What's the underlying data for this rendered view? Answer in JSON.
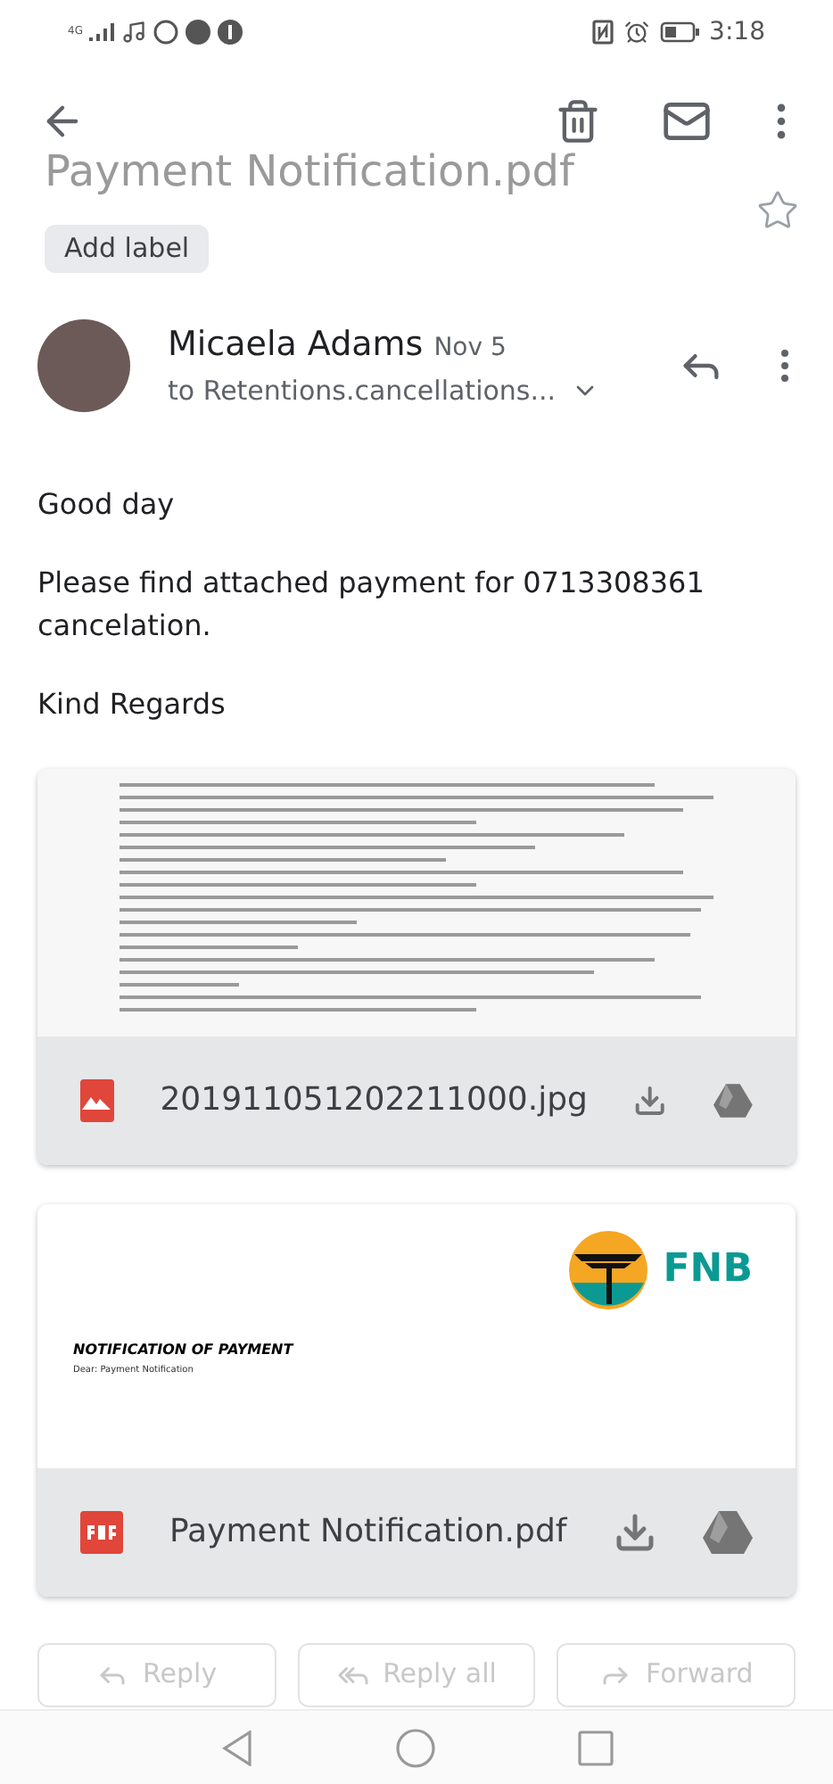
{
  "status_bar": {
    "network": "4G",
    "time": "3:18"
  },
  "subject": {
    "title": "Payment Notification.pdf",
    "starred": false
  },
  "label_chip": "Add label",
  "message": {
    "sender": "Micaela Adams",
    "date": "Nov 5",
    "recipients": "to Retentions.cancellations..."
  },
  "body": [
    "Good day",
    "Please find attached payment for 0713308361 cancelation.",
    "Kind Regards"
  ],
  "attachments": [
    {
      "kind": "image",
      "filename": "201911051202211000.jpg"
    },
    {
      "kind": "pdf",
      "filename": "Payment Notification.pdf",
      "preview": {
        "logo_text": "FNB",
        "heading": "NOTIFICATION OF PAYMENT",
        "salutation": "Dear: Payment Notification"
      }
    }
  ],
  "actions": [
    {
      "kind": "reply",
      "label": "Reply"
    },
    {
      "kind": "reply_all",
      "label": "Reply all"
    },
    {
      "kind": "forward",
      "label": "Forward"
    }
  ]
}
